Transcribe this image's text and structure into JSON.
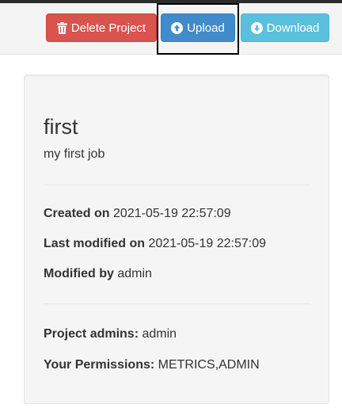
{
  "toolbar": {
    "delete_label": "Delete Project",
    "upload_label": "Upload",
    "download_label": "Download"
  },
  "project": {
    "name": "first",
    "description": "my first job",
    "created_on_label": "Created on",
    "created_on": "2021-05-19 22:57:09",
    "last_modified_label": "Last modified on",
    "last_modified": "2021-05-19 22:57:09",
    "modified_by_label": "Modified by",
    "modified_by": "admin",
    "admins_label": "Project admins:",
    "admins": "admin",
    "permissions_label": "Your Permissions:",
    "permissions": "METRICS,ADMIN"
  },
  "colors": {
    "delete": "#d9534f",
    "upload": "#428bca",
    "download": "#5bc0de"
  },
  "icons": {
    "delete": "trash-icon",
    "upload": "circle-arrow-up-icon",
    "download": "circle-arrow-down-icon"
  }
}
